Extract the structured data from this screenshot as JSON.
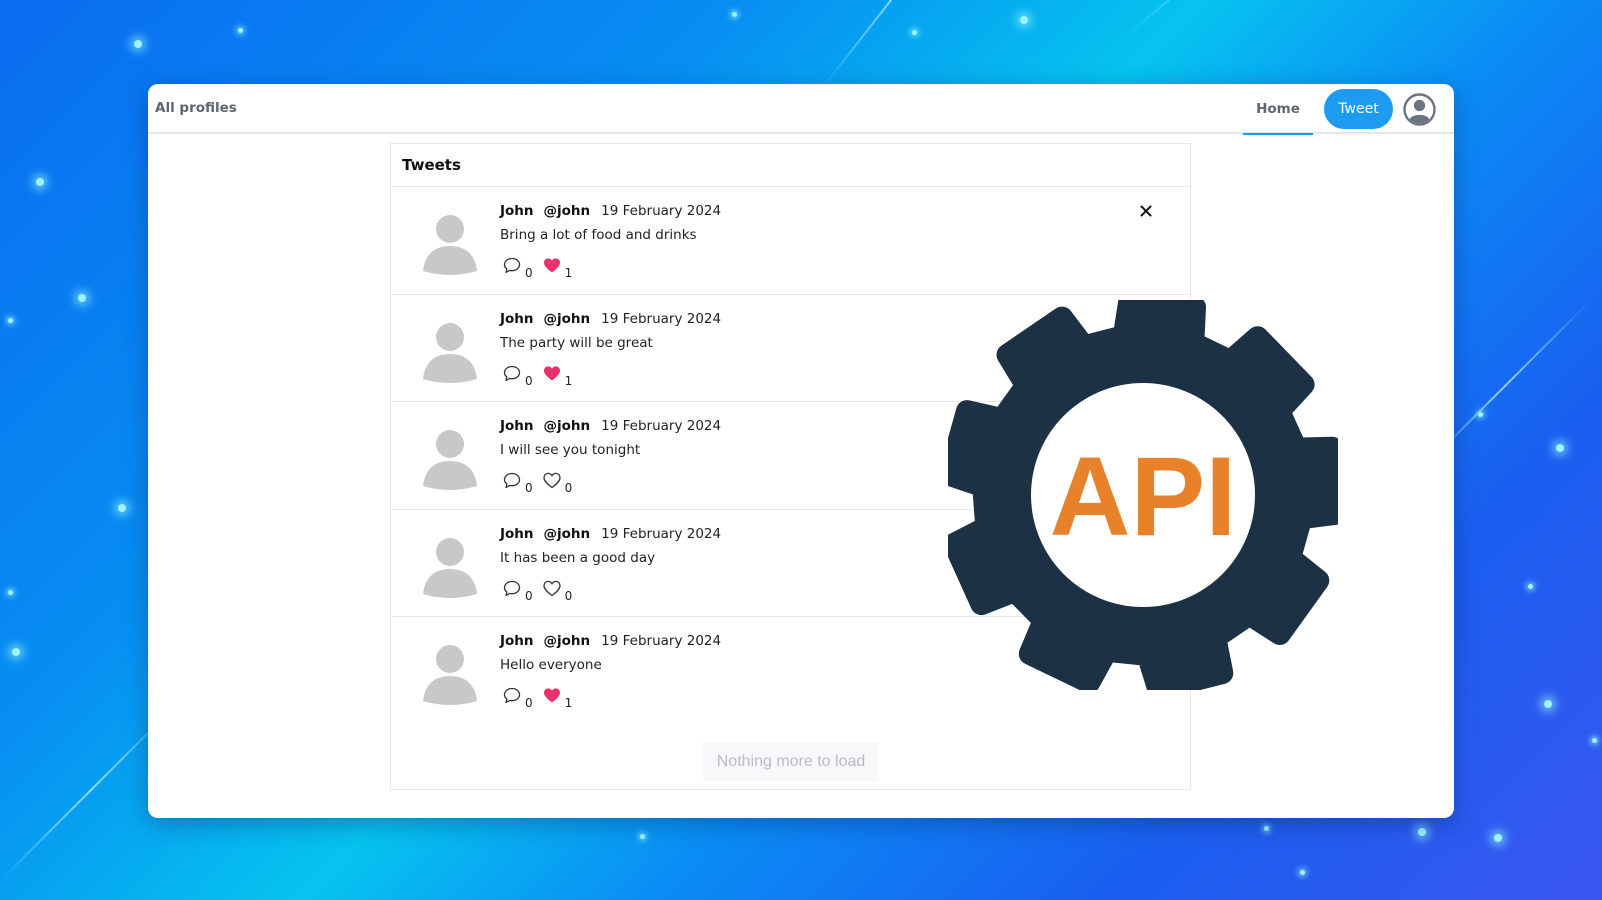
{
  "navbar": {
    "brand": "All profiles",
    "home_label": "Home",
    "tweet_label": "Tweet",
    "profile_icon": "user-circle-icon"
  },
  "feed": {
    "title": "Tweets",
    "tweets": [
      {
        "name": "John",
        "handle": "@john",
        "date": "19 February 2024",
        "text": "Bring a lot of food and drinks",
        "comments": "0",
        "likes": "1",
        "liked": true,
        "deletable": true
      },
      {
        "name": "John",
        "handle": "@john",
        "date": "19 February 2024",
        "text": "The party will be great",
        "comments": "0",
        "likes": "1",
        "liked": true,
        "deletable": true
      },
      {
        "name": "John",
        "handle": "@john",
        "date": "19 February 2024",
        "text": "I will see you tonight",
        "comments": "0",
        "likes": "0",
        "liked": false,
        "deletable": false
      },
      {
        "name": "John",
        "handle": "@john",
        "date": "19 February 2024",
        "text": "It has been a good day",
        "comments": "0",
        "likes": "0",
        "liked": false,
        "deletable": false
      },
      {
        "name": "John",
        "handle": "@john",
        "date": "19 February 2024",
        "text": "Hello everyone",
        "comments": "0",
        "likes": "1",
        "liked": true,
        "deletable": false
      }
    ],
    "load_more_label": "Nothing more to load"
  },
  "overlay": {
    "logo_text": "API",
    "gear_color": "#1c3144",
    "text_color": "#e8822a"
  },
  "colors": {
    "accent": "#1d9bf0",
    "like": "#e8336a"
  }
}
